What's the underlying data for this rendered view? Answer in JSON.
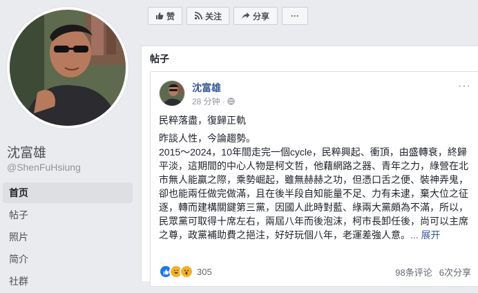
{
  "profile": {
    "name": "沈富雄",
    "handle": "@ShenFuHsiung"
  },
  "nav": {
    "items": [
      "首页",
      "帖子",
      "照片",
      "简介",
      "社群"
    ]
  },
  "actions": {
    "like_label": "赞",
    "follow_label": "关注",
    "share_label": "分享",
    "more_label": "···"
  },
  "section": {
    "title": "帖子"
  },
  "post": {
    "author": "沈富雄",
    "time": "28 分钟",
    "menu": "···",
    "lines": [
      "民粹落盡，復歸正軌",
      "昨談人性，今論趨勢。",
      "2015～2024，10年間走完一個cycle，民粹興起、衝頂，由盛轉衰，終歸平淡，這期間的中心人物是柯文哲，他藉網路之器、青年之力，綠營在北市無人能贏之際，乘勢崛起，雖無赫赫之功，但憑口舌之便、裝神弄鬼，卻也能兩任做完做滿，且在後半段自知能量不足、力有未逮，棄大位之征逐，轉而建構關鍵第三黨，因國人此時對藍、綠兩大黨頗為不滿，所以，民眾黨可取得十席左右，兩屆八年而後泡沫，柯市長卸任後，尚可以主席之尊，政黨補助費之挹注，好好玩個八年，老運差強人意。"
    ],
    "see_more": "... 展开",
    "reaction_count": "305",
    "comments": "98条评论",
    "shares": "6次分享"
  },
  "colors": {
    "background": "#e9ebee",
    "link": "#365899",
    "like_blue": "#1877f2",
    "haha_yellow": "#f7b125"
  },
  "icons": {
    "like": "thumbs-up-icon",
    "follow": "rss-icon",
    "share": "share-arrow-icon",
    "privacy": "globe-icon",
    "reactions": [
      "like-icon",
      "haha-icon",
      "wow-icon"
    ]
  }
}
